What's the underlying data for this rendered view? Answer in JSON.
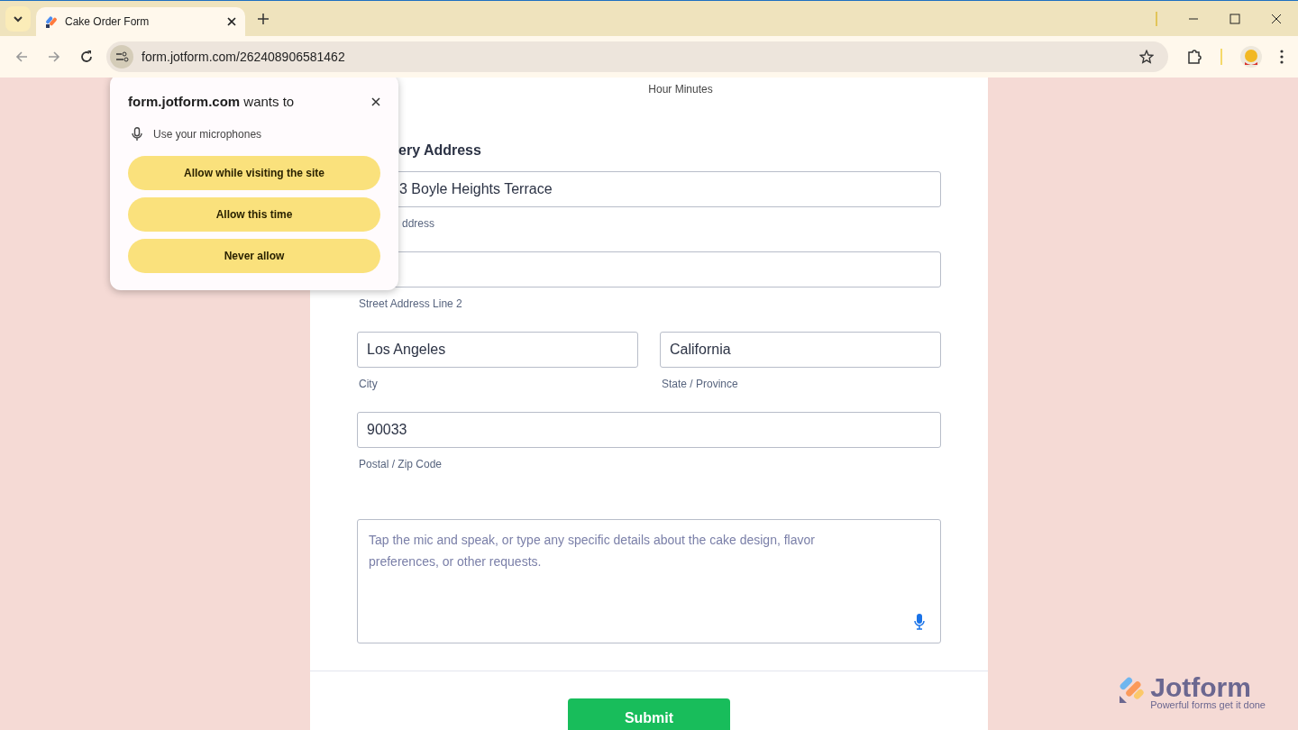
{
  "browser": {
    "tab": {
      "title": "Cake Order Form",
      "selected": true
    },
    "address": "form.jotform.com/262408906581462"
  },
  "form": {
    "time_sublabel": "Hour Minutes",
    "address_label": "ery Address",
    "fields": [
      {
        "kind": "clipped",
        "value": "3 Boyle Heights Terrace",
        "sublabel": "ddress"
      },
      {
        "kind": "wide",
        "sublabel": "Street Address Line 2"
      },
      {
        "kind": "half",
        "value": "Los Angeles",
        "sublabel": "City"
      },
      {
        "kind": "half",
        "value": "California",
        "sublabel": "State / Province"
      },
      {
        "kind": "wide",
        "value": "90033",
        "sublabel": "Postal / Zip Code"
      }
    ],
    "details": {
      "placeholder": "Tap the mic and speak, or type any specific details about the cake design, flavor preferences, or other requests."
    },
    "submit": "Submit"
  },
  "permission_popup": {
    "site": "form.jotform.com",
    "title_rest": "wants to",
    "permission": "Use your microphones",
    "buttons": [
      "Allow while visiting the site",
      "Allow this time",
      "Never allow"
    ]
  },
  "badge": {
    "name": "Jotform",
    "tagline": "Powerful forms get it done"
  }
}
